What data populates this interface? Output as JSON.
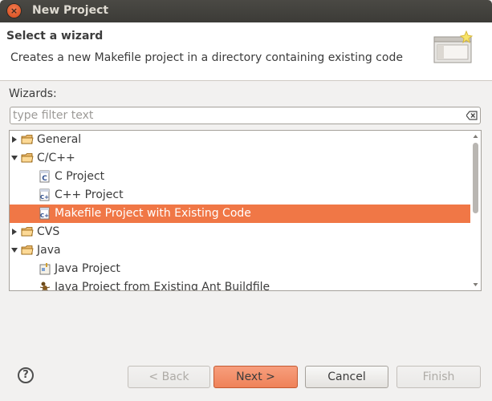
{
  "window": {
    "title": "New Project",
    "close_label": "×"
  },
  "header": {
    "title": "Select a wizard",
    "description": "Creates a new Makefile project in a directory containing existing code"
  },
  "wizards_label": "Wizards:",
  "filter": {
    "placeholder": "type filter text",
    "value": ""
  },
  "tree": [
    {
      "label": "General",
      "type": "folder",
      "expanded": false,
      "level": 0
    },
    {
      "label": "C/C++",
      "type": "folder",
      "expanded": true,
      "level": 0
    },
    {
      "label": "C Project",
      "type": "c-project",
      "level": 1
    },
    {
      "label": "C++ Project",
      "type": "cpp-project",
      "level": 1
    },
    {
      "label": "Makefile Project with Existing Code",
      "type": "cpp-project",
      "level": 1,
      "selected": true
    },
    {
      "label": "CVS",
      "type": "folder",
      "expanded": false,
      "level": 0
    },
    {
      "label": "Java",
      "type": "folder",
      "expanded": true,
      "level": 0
    },
    {
      "label": "Java Project",
      "type": "java-project",
      "level": 1
    },
    {
      "label": "Java Project from Existing Ant Buildfile",
      "type": "ant-project",
      "level": 1
    }
  ],
  "buttons": {
    "help": "?",
    "back": "< Back",
    "next": "Next >",
    "cancel": "Cancel",
    "finish": "Finish"
  },
  "colors": {
    "selection": "#f07746",
    "titlebar": "#3c3b37",
    "primary_button": "#ef8259"
  }
}
